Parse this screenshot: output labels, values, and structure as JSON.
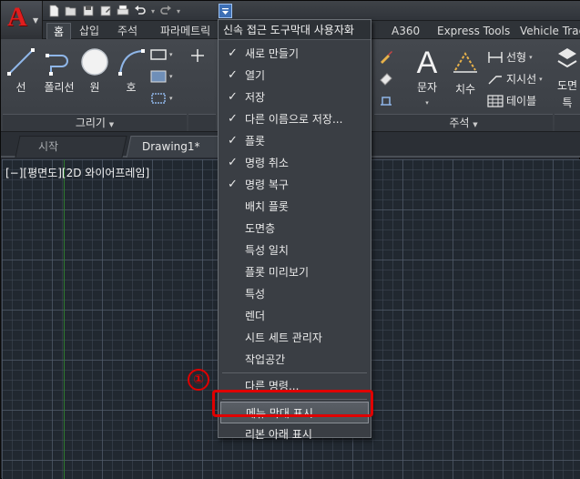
{
  "app": {
    "logo_letter": "A"
  },
  "quick_access": {
    "icons": [
      "new-file-icon",
      "open-folder-icon",
      "save-icon",
      "save-as-icon",
      "print-icon",
      "undo-icon",
      "redo-icon"
    ]
  },
  "ribbon_tabs": [
    {
      "label": "홈",
      "active": true
    },
    {
      "label": "삽입"
    },
    {
      "label": "주석"
    },
    {
      "label": "파라메트릭"
    },
    {
      "label": "A360"
    },
    {
      "label": "Express Tools"
    },
    {
      "label": "Vehicle Trac"
    }
  ],
  "ribbon": {
    "draw_tools": [
      "선",
      "폴리선",
      "원",
      "호"
    ],
    "draw_panel_label": "그리기",
    "annotation_tools": {
      "text": "문자",
      "dimension": "치수",
      "linear": "선형",
      "leader": "지시선",
      "table": "테이블"
    },
    "annotation_panel_label": "주석",
    "cutoff_label_1": "도면",
    "cutoff_label_2": "특"
  },
  "file_tabs": [
    {
      "label": "시작"
    },
    {
      "label": "Drawing1*",
      "active": true
    }
  ],
  "viewport": {
    "label": "[−][평면도][2D 와이어프레임]"
  },
  "menu": {
    "header": "신속 접근 도구막대 사용자화",
    "items": [
      {
        "label": "새로 만들기",
        "checked": true
      },
      {
        "label": "열기",
        "checked": true
      },
      {
        "label": "저장",
        "checked": true
      },
      {
        "label": "다른 이름으로 저장...",
        "checked": true
      },
      {
        "label": "플롯",
        "checked": true
      },
      {
        "label": "명령 취소",
        "checked": true
      },
      {
        "label": "명령 복구",
        "checked": true
      },
      {
        "label": "배치 플롯",
        "checked": false
      },
      {
        "label": "도면층",
        "checked": false
      },
      {
        "label": "특성 일치",
        "checked": false
      },
      {
        "label": "플롯 미리보기",
        "checked": false
      },
      {
        "label": "특성",
        "checked": false
      },
      {
        "label": "렌더",
        "checked": false
      },
      {
        "label": "시트 세트 관리자",
        "checked": false
      },
      {
        "label": "작업공간",
        "checked": false
      }
    ],
    "more_commands": "다른 명령...",
    "show_menu_bar": "메뉴 막대 표시",
    "show_below_ribbon": "리본 아래 표시"
  },
  "annotation": {
    "step_number": "①"
  },
  "colors": {
    "highlight_red": "#e00000",
    "accent_blue": "#3d6fb5",
    "logo_red": "#e01e1e"
  }
}
